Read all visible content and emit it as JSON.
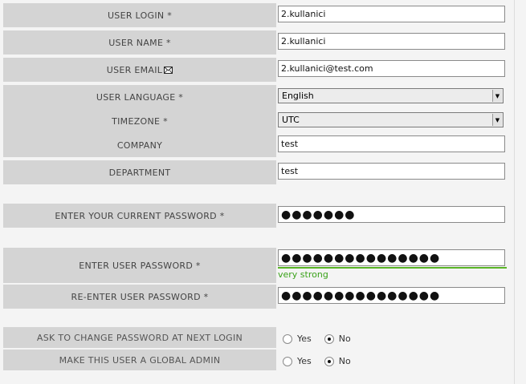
{
  "form": {
    "user_login": {
      "label": "USER LOGIN *",
      "value": "2.kullanici"
    },
    "user_name": {
      "label": "USER NAME *",
      "value": "2.kullanici"
    },
    "user_email": {
      "label": "USER EMAIL",
      "icon": "envelope-icon",
      "value": "2.kullanici@test.com"
    },
    "user_language": {
      "label": "USER LANGUAGE *",
      "selected": "English"
    },
    "timezone": {
      "label": "TIMEZONE *",
      "selected": "UTC"
    },
    "company": {
      "label": "COMPANY",
      "value": "test"
    },
    "department": {
      "label": "DEPARTMENT",
      "value": "test"
    },
    "current_password": {
      "label": "ENTER YOUR CURRENT PASSWORD *",
      "masked": "●●●●●●●"
    },
    "new_password": {
      "label": "ENTER USER PASSWORD *",
      "masked": "●●●●●●●●●●●●●●●",
      "strength": "very strong",
      "strength_color": "#3aa21a"
    },
    "reenter_password": {
      "label": "RE-ENTER USER PASSWORD *",
      "masked": "●●●●●●●●●●●●●●●"
    },
    "ask_change_password": {
      "label": "ASK TO CHANGE PASSWORD AT NEXT LOGIN",
      "options": [
        "Yes",
        "No"
      ],
      "selected": "No"
    },
    "global_admin": {
      "label": "MAKE THIS USER A GLOBAL ADMIN",
      "options": [
        "Yes",
        "No"
      ],
      "selected": "No"
    }
  }
}
